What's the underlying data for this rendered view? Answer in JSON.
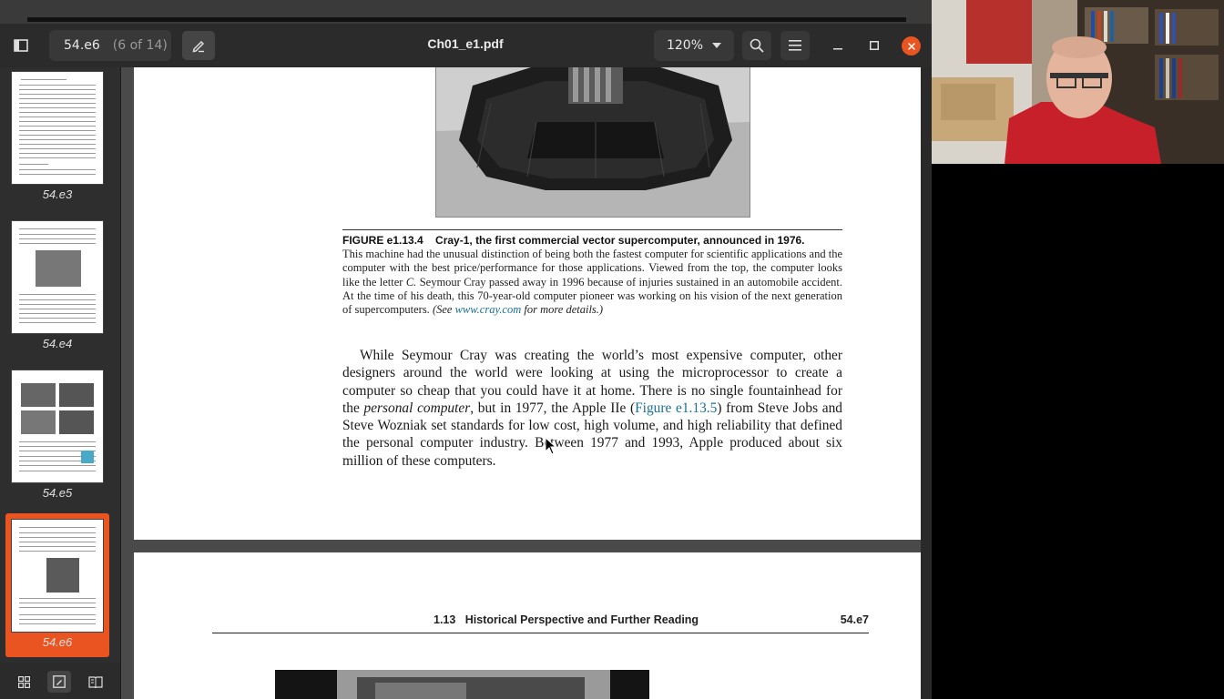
{
  "window": {
    "title": "Ch01_e1.pdf",
    "page_current": "54.e6",
    "page_count": "(6 of 14)",
    "zoom": "120%"
  },
  "sidebar": {
    "thumbnails": [
      {
        "label": "54.e3"
      },
      {
        "label": "54.e4"
      },
      {
        "label": "54.e5"
      },
      {
        "label": "54.e6",
        "selected": true
      }
    ]
  },
  "page1": {
    "caption_head": "FIGURE e1.13.4    Cray-1, the first commercial vector supercomputer, announced in 1976.",
    "caption_body": "This machine had the unusual distinction of being both the fastest computer for scientific applications and the computer with the best price/performance for those applications. Viewed from the top, the computer looks like the letter ",
    "caption_c": "C.",
    "caption_body2": " Seymour Cray passed away in 1996 because of injuries sustained in an automobile accident. At the time of his death, this 70-year-old computer pioneer was working on his vision of the next generation of supercomputers. ",
    "caption_see": "(See ",
    "caption_link": "www.cray.com",
    "caption_see2": " for more details.)",
    "para_a": "While Seymour Cray was creating the world’s most expensive computer, other designers around the world were looking at using the microprocessor to create a computer so cheap that you could have it at home. There is no single fountainhead for the ",
    "para_em": "personal computer",
    "para_b": ", but in 1977, the Apple IIe (",
    "para_link": "Figure e1.13.5",
    "para_c": ") from Steve Jobs and Steve Wozniak set standards for low cost, high volume, and high reliability that defined the personal computer industry. Between 1977 and 1993, Apple produced about six million of these computers."
  },
  "page2": {
    "section": "1.13   Historical Perspective and Further Reading",
    "page_number": "54.e7"
  },
  "colors": {
    "accent": "#e95420",
    "link": "#1a6f96"
  },
  "icons": [
    "sidebar-icon",
    "pencil-icon",
    "chevron-down-icon",
    "search-icon",
    "hamburger-icon",
    "minimize-icon",
    "maximize-icon",
    "close-icon",
    "grid-icon",
    "annotation-icon",
    "book-icon"
  ]
}
